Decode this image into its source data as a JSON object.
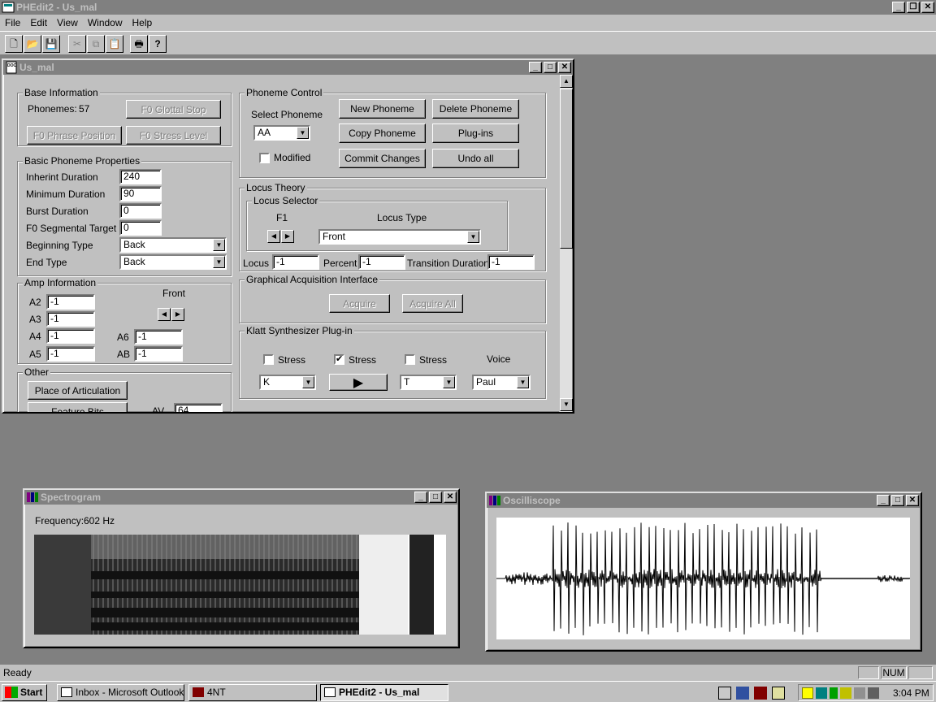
{
  "app": {
    "title": "PHEdit2 - Us_mal"
  },
  "menu": [
    "File",
    "Edit",
    "View",
    "Window",
    "Help"
  ],
  "toolbar": {
    "icons": [
      "new-icon",
      "open-icon",
      "save-icon",
      "cut-icon",
      "copy-icon",
      "paste-icon",
      "print-icon",
      "help-icon"
    ]
  },
  "doc": {
    "title": "Us_mal",
    "base": {
      "legend": "Base Information",
      "phonemes_label": "Phonemes:",
      "phonemes_value": "57",
      "f0_glottal": "F0 Glottal Stop",
      "f0_phrase": "F0 Phrase Position",
      "f0_stress": "F0 Stress Level"
    },
    "basic": {
      "legend": "Basic Phoneme Properties",
      "inherit_label": "Inherint Duration",
      "inherit_value": "240",
      "min_label": "Minimum Duration",
      "min_value": "90",
      "burst_label": "Burst Duration",
      "burst_value": "0",
      "f0seg_label": "F0 Segmental Target",
      "f0seg_value": "0",
      "begin_label": "Beginning Type",
      "begin_value": "Back",
      "end_label": "End Type",
      "end_value": "Back"
    },
    "amp": {
      "legend": "Amp Information",
      "front": "Front",
      "a2_label": "A2",
      "a2": "-1",
      "a3_label": "A3",
      "a3": "-1",
      "a4_label": "A4",
      "a4": "-1",
      "a5_label": "A5",
      "a5": "-1",
      "a6_label": "A6",
      "a6": "-1",
      "ab_label": "AB",
      "ab": "-1"
    },
    "other": {
      "legend": "Other",
      "place": "Place of Articulation",
      "feature": "Feature Bits",
      "av_label": "AV",
      "av_value": "64"
    },
    "phoneme_control": {
      "legend": "Phoneme Control",
      "select_label": "Select Phoneme",
      "select_value": "AA",
      "modified": "Modified",
      "new": "New Phoneme",
      "delete": "Delete Phoneme",
      "copy": "Copy Phoneme",
      "plugins": "Plug-ins",
      "commit": "Commit Changes",
      "undo": "Undo all"
    },
    "locus": {
      "legend": "Locus Theory",
      "selector_legend": "Locus Selector",
      "f1": "F1",
      "type_label": "Locus Type",
      "type_value": "Front",
      "locus_label": "Locus",
      "locus_value": "-1",
      "percent_label": "Percent",
      "percent_value": "-1",
      "trans_label": "Transition Duration",
      "trans_value": "-1"
    },
    "graphical": {
      "legend": "Graphical Acquisition Interface",
      "acquire": "Acquire",
      "acquire_all": "Acquire All"
    },
    "klatt": {
      "legend": "Klatt Synthesizer Plug-in",
      "stress1": "Stress",
      "stress2": "Stress",
      "stress3": "Stress",
      "voice_label": "Voice",
      "combo1": "K",
      "combo2": "T",
      "voice": "Paul",
      "stress2_checked": true
    }
  },
  "spectrogram": {
    "title": "Spectrogram",
    "freq_label": "Frequency:",
    "freq_value": "602 Hz"
  },
  "oscilloscope": {
    "title": "Oscilliscope"
  },
  "status": {
    "text": "Ready",
    "num": "NUM"
  },
  "taskbar": {
    "start": "Start",
    "tasks": [
      "Inbox - Microsoft Outlook",
      "4NT",
      "PHEdit2 - Us_mal"
    ],
    "clock": "3:04 PM"
  }
}
